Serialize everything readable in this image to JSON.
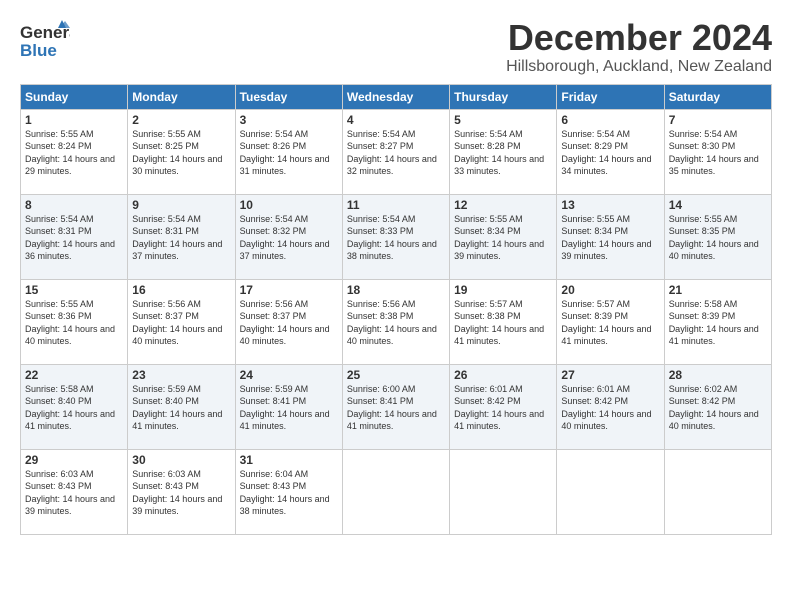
{
  "header": {
    "logo_line1": "General",
    "logo_line2": "Blue",
    "month": "December 2024",
    "location": "Hillsborough, Auckland, New Zealand"
  },
  "days_of_week": [
    "Sunday",
    "Monday",
    "Tuesday",
    "Wednesday",
    "Thursday",
    "Friday",
    "Saturday"
  ],
  "weeks": [
    [
      {
        "day": "1",
        "sunrise": "Sunrise: 5:55 AM",
        "sunset": "Sunset: 8:24 PM",
        "daylight": "Daylight: 14 hours and 29 minutes."
      },
      {
        "day": "2",
        "sunrise": "Sunrise: 5:55 AM",
        "sunset": "Sunset: 8:25 PM",
        "daylight": "Daylight: 14 hours and 30 minutes."
      },
      {
        "day": "3",
        "sunrise": "Sunrise: 5:54 AM",
        "sunset": "Sunset: 8:26 PM",
        "daylight": "Daylight: 14 hours and 31 minutes."
      },
      {
        "day": "4",
        "sunrise": "Sunrise: 5:54 AM",
        "sunset": "Sunset: 8:27 PM",
        "daylight": "Daylight: 14 hours and 32 minutes."
      },
      {
        "day": "5",
        "sunrise": "Sunrise: 5:54 AM",
        "sunset": "Sunset: 8:28 PM",
        "daylight": "Daylight: 14 hours and 33 minutes."
      },
      {
        "day": "6",
        "sunrise": "Sunrise: 5:54 AM",
        "sunset": "Sunset: 8:29 PM",
        "daylight": "Daylight: 14 hours and 34 minutes."
      },
      {
        "day": "7",
        "sunrise": "Sunrise: 5:54 AM",
        "sunset": "Sunset: 8:30 PM",
        "daylight": "Daylight: 14 hours and 35 minutes."
      }
    ],
    [
      {
        "day": "8",
        "sunrise": "Sunrise: 5:54 AM",
        "sunset": "Sunset: 8:31 PM",
        "daylight": "Daylight: 14 hours and 36 minutes."
      },
      {
        "day": "9",
        "sunrise": "Sunrise: 5:54 AM",
        "sunset": "Sunset: 8:31 PM",
        "daylight": "Daylight: 14 hours and 37 minutes."
      },
      {
        "day": "10",
        "sunrise": "Sunrise: 5:54 AM",
        "sunset": "Sunset: 8:32 PM",
        "daylight": "Daylight: 14 hours and 37 minutes."
      },
      {
        "day": "11",
        "sunrise": "Sunrise: 5:54 AM",
        "sunset": "Sunset: 8:33 PM",
        "daylight": "Daylight: 14 hours and 38 minutes."
      },
      {
        "day": "12",
        "sunrise": "Sunrise: 5:55 AM",
        "sunset": "Sunset: 8:34 PM",
        "daylight": "Daylight: 14 hours and 39 minutes."
      },
      {
        "day": "13",
        "sunrise": "Sunrise: 5:55 AM",
        "sunset": "Sunset: 8:34 PM",
        "daylight": "Daylight: 14 hours and 39 minutes."
      },
      {
        "day": "14",
        "sunrise": "Sunrise: 5:55 AM",
        "sunset": "Sunset: 8:35 PM",
        "daylight": "Daylight: 14 hours and 40 minutes."
      }
    ],
    [
      {
        "day": "15",
        "sunrise": "Sunrise: 5:55 AM",
        "sunset": "Sunset: 8:36 PM",
        "daylight": "Daylight: 14 hours and 40 minutes."
      },
      {
        "day": "16",
        "sunrise": "Sunrise: 5:56 AM",
        "sunset": "Sunset: 8:37 PM",
        "daylight": "Daylight: 14 hours and 40 minutes."
      },
      {
        "day": "17",
        "sunrise": "Sunrise: 5:56 AM",
        "sunset": "Sunset: 8:37 PM",
        "daylight": "Daylight: 14 hours and 40 minutes."
      },
      {
        "day": "18",
        "sunrise": "Sunrise: 5:56 AM",
        "sunset": "Sunset: 8:38 PM",
        "daylight": "Daylight: 14 hours and 40 minutes."
      },
      {
        "day": "19",
        "sunrise": "Sunrise: 5:57 AM",
        "sunset": "Sunset: 8:38 PM",
        "daylight": "Daylight: 14 hours and 41 minutes."
      },
      {
        "day": "20",
        "sunrise": "Sunrise: 5:57 AM",
        "sunset": "Sunset: 8:39 PM",
        "daylight": "Daylight: 14 hours and 41 minutes."
      },
      {
        "day": "21",
        "sunrise": "Sunrise: 5:58 AM",
        "sunset": "Sunset: 8:39 PM",
        "daylight": "Daylight: 14 hours and 41 minutes."
      }
    ],
    [
      {
        "day": "22",
        "sunrise": "Sunrise: 5:58 AM",
        "sunset": "Sunset: 8:40 PM",
        "daylight": "Daylight: 14 hours and 41 minutes."
      },
      {
        "day": "23",
        "sunrise": "Sunrise: 5:59 AM",
        "sunset": "Sunset: 8:40 PM",
        "daylight": "Daylight: 14 hours and 41 minutes."
      },
      {
        "day": "24",
        "sunrise": "Sunrise: 5:59 AM",
        "sunset": "Sunset: 8:41 PM",
        "daylight": "Daylight: 14 hours and 41 minutes."
      },
      {
        "day": "25",
        "sunrise": "Sunrise: 6:00 AM",
        "sunset": "Sunset: 8:41 PM",
        "daylight": "Daylight: 14 hours and 41 minutes."
      },
      {
        "day": "26",
        "sunrise": "Sunrise: 6:01 AM",
        "sunset": "Sunset: 8:42 PM",
        "daylight": "Daylight: 14 hours and 41 minutes."
      },
      {
        "day": "27",
        "sunrise": "Sunrise: 6:01 AM",
        "sunset": "Sunset: 8:42 PM",
        "daylight": "Daylight: 14 hours and 40 minutes."
      },
      {
        "day": "28",
        "sunrise": "Sunrise: 6:02 AM",
        "sunset": "Sunset: 8:42 PM",
        "daylight": "Daylight: 14 hours and 40 minutes."
      }
    ],
    [
      {
        "day": "29",
        "sunrise": "Sunrise: 6:03 AM",
        "sunset": "Sunset: 8:43 PM",
        "daylight": "Daylight: 14 hours and 39 minutes."
      },
      {
        "day": "30",
        "sunrise": "Sunrise: 6:03 AM",
        "sunset": "Sunset: 8:43 PM",
        "daylight": "Daylight: 14 hours and 39 minutes."
      },
      {
        "day": "31",
        "sunrise": "Sunrise: 6:04 AM",
        "sunset": "Sunset: 8:43 PM",
        "daylight": "Daylight: 14 hours and 38 minutes."
      },
      null,
      null,
      null,
      null
    ]
  ]
}
